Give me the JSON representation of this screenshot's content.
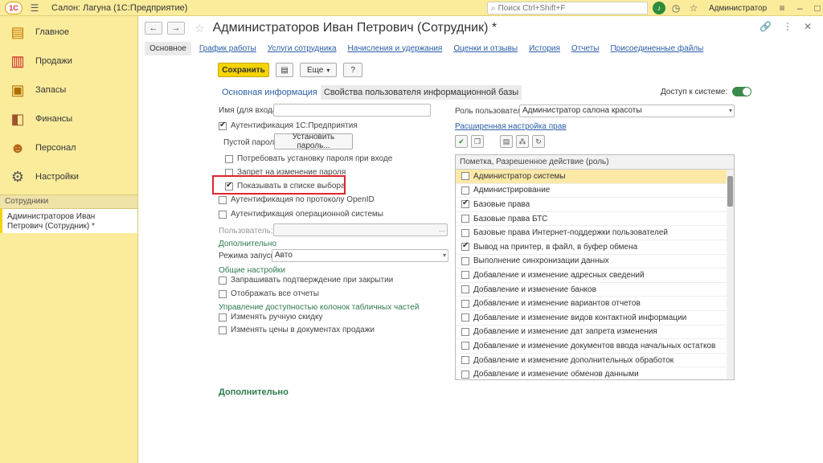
{
  "app": {
    "title": "Салон: Лагуна  (1С:Предприятие)",
    "search_placeholder": "Поиск Ctrl+Shift+F",
    "user": "Администратор"
  },
  "sidebar": {
    "items": [
      {
        "label": "Главное",
        "icon": "menu-list-icon"
      },
      {
        "label": "Продажи",
        "icon": "chart-icon"
      },
      {
        "label": "Запасы",
        "icon": "box-icon"
      },
      {
        "label": "Финансы",
        "icon": "wallet-icon"
      },
      {
        "label": "Персонал",
        "icon": "people-icon"
      },
      {
        "label": "Настройки",
        "icon": "gear-icon"
      }
    ],
    "section": "Сотрудники",
    "open_doc": "Администраторов Иван Петрович (Сотрудник) *"
  },
  "doc": {
    "title": "Администраторов Иван Петрович (Сотрудник) *"
  },
  "tabs": [
    {
      "label": "Основное",
      "active": true
    },
    {
      "label": "График работы"
    },
    {
      "label": "Услуги сотрудника"
    },
    {
      "label": "Начисления и удержания"
    },
    {
      "label": "Оценки и отзывы"
    },
    {
      "label": "История"
    },
    {
      "label": "Отчеты"
    },
    {
      "label": "Присоединенные файлы"
    }
  ],
  "toolbar": {
    "save": "Сохранить",
    "more": "Еще",
    "help": "?"
  },
  "subtabs": {
    "main": "Основная информация",
    "ib": "Свойства пользователя информационной базы"
  },
  "access_label": "Доступ к системе:",
  "form": {
    "login_label": "Имя (для входа):",
    "login_value": "",
    "auth_1c": "Аутентификация 1С:Предприятия",
    "empty_password": "Пустой пароль",
    "set_password": "Установить пароль...",
    "require_password": "Потребовать установку пароля при входе",
    "deny_password_change": "Запрет на изменение пароля",
    "show_in_list": "Показывать в списке выбора",
    "auth_openid": "Аутентификация по протоколу OpenID",
    "auth_os": "Аутентификация операционной системы",
    "user_label": "Пользователь:",
    "additional": "Дополнительно",
    "launch_mode_label": "Режима запуска:",
    "launch_mode_value": "Авто",
    "general_settings": "Общие настройки",
    "confirm_close": "Запрашивать подтверждение при закрытии",
    "show_all_reports": "Отображать все отчеты",
    "columns_access": "Управление доступностью колонок табличных частей",
    "change_discount": "Изменять ручную скидку",
    "change_prices": "Изменять цены в документах продажи",
    "footer_section": "Дополнительно"
  },
  "role": {
    "label": "Роль пользователя:",
    "value": "Администратор салона красоты",
    "advanced_link": "Расширенная настройка прав",
    "table_header": "Пометка, Разрешенное действие (роль)",
    "rows": [
      {
        "label": "Администратор системы",
        "checked": false,
        "selected": true
      },
      {
        "label": "Администрирование",
        "checked": false
      },
      {
        "label": "Базовые права",
        "checked": true
      },
      {
        "label": "Базовые права БТС",
        "checked": false
      },
      {
        "label": "Базовые права Интернет-поддержки пользователей",
        "checked": false
      },
      {
        "label": "Вывод на принтер, в файл, в буфер обмена",
        "checked": true
      },
      {
        "label": "Выполнение синхронизации данных",
        "checked": false
      },
      {
        "label": "Добавление и изменение адресных сведений",
        "checked": false
      },
      {
        "label": "Добавление и изменение банков",
        "checked": false
      },
      {
        "label": "Добавление и изменение вариантов отчетов",
        "checked": false
      },
      {
        "label": "Добавление и изменение видов контактной информации",
        "checked": false
      },
      {
        "label": "Добавление и изменение дат запрета изменения",
        "checked": false
      },
      {
        "label": "Добавление и изменение документов ввода начальных остатков",
        "checked": false
      },
      {
        "label": "Добавление и изменение дополнительных обработок",
        "checked": false
      },
      {
        "label": "Добавление и изменение обменов данными",
        "checked": false
      }
    ]
  }
}
